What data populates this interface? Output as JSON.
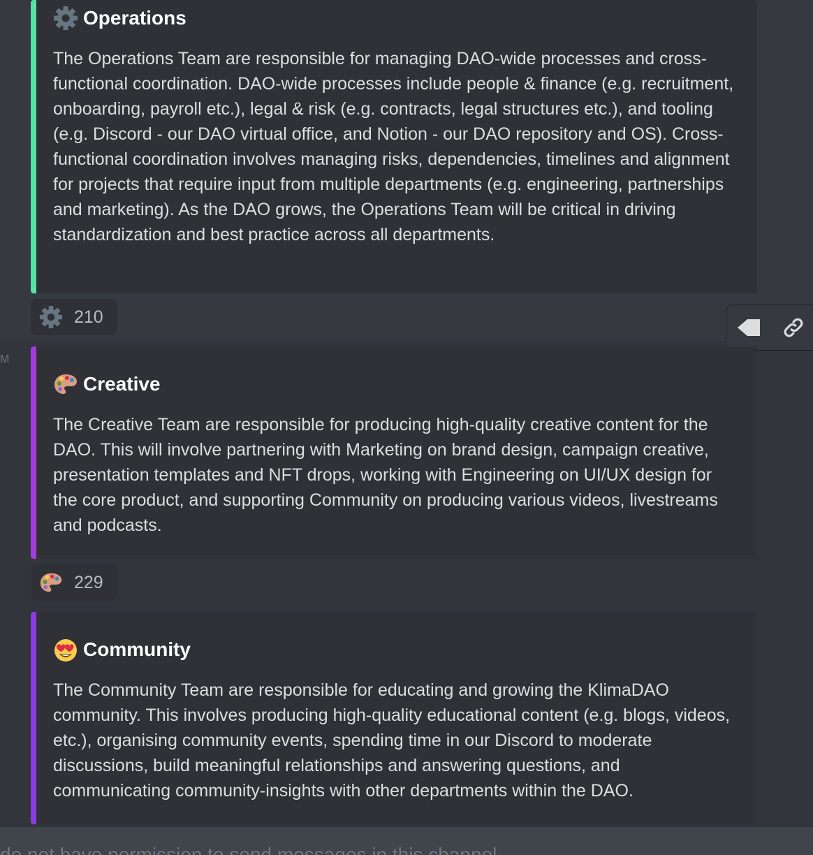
{
  "background_stub": "M",
  "embeds": [
    {
      "title": "Operations",
      "icon": "gear-icon",
      "accent": "#57e3a1",
      "description": "The Operations Team are responsible for managing DAO-wide processes and cross-functional coordination. DAO-wide processes include people & finance (e.g. recruitment, onboarding, payroll etc.), legal & risk (e.g. contracts, legal structures etc.), and tooling (e.g. Discord - our DAO virtual office, and Notion - our DAO repository and OS). Cross-functional coordination involves managing risks, dependencies, timelines and alignment for projects that require input from multiple departments (e.g. engineering, partnerships and marketing). As the DAO grows, the Operations Team will be critical in driving standardization and best practice across all departments.",
      "reaction_count": "210"
    },
    {
      "title": "Creative",
      "icon": "artist-palette-icon",
      "accent": "#a43cdd",
      "description": "The Creative Team are responsible for producing high-quality creative content for the DAO. This will involve partnering with Marketing on brand design, campaign creative, presentation templates and NFT drops, working with Engineering on UI/UX design for the core product, and supporting Community on producing various videos, livestreams and podcasts.",
      "reaction_count": "229"
    },
    {
      "title": "Community",
      "icon": "heart-eyes-icon",
      "accent": "#8b3be0",
      "description": "The Community Team are responsible for educating and growing the KlimaDAO community. This involves producing high-quality educational content (e.g. blogs, videos, etc.), organising community events, spending time in our Discord to moderate discussions, build meaningful relationships and answering questions, and communicating community-insights with other departments within the DAO."
    }
  ],
  "toolbar": {
    "icons": [
      "arrow-left-icon",
      "link-icon"
    ]
  },
  "input_bar": {
    "text": "do not have permission to send messages in this channel."
  }
}
